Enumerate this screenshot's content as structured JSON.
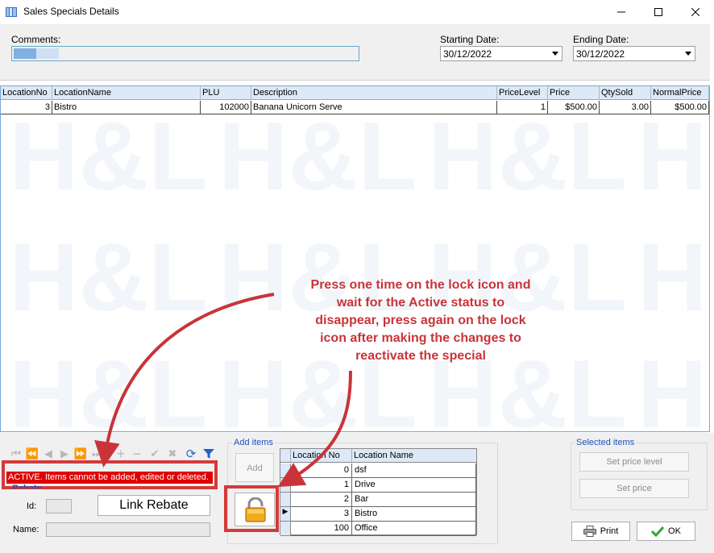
{
  "window": {
    "title": "Sales Specials Details"
  },
  "header": {
    "comments_label": "Comments:",
    "comments_value": "",
    "starting_date_label": "Starting Date:",
    "starting_date_value": "30/12/2022",
    "ending_date_label": "Ending Date:",
    "ending_date_value": "30/12/2022"
  },
  "grid": {
    "columns": [
      "LocationNo",
      "LocationName",
      "PLU",
      "Description",
      "PriceLevel",
      "Price",
      "QtySold",
      "NormalPrice"
    ],
    "rows": [
      [
        "3",
        "Bistro",
        "102000",
        "Banana Unicorn Serve",
        "1",
        "$500.00",
        "3.00",
        "$500.00"
      ]
    ]
  },
  "rebate": {
    "status_text": "ACTIVE.  Items cannot be added, edited or deleted.",
    "group_title": "Rebate",
    "id_label": "Id:",
    "name_label": "Name:",
    "link_rebate_label": "Link Rebate"
  },
  "add_items": {
    "title": "Add items",
    "add_label": "Add",
    "table": {
      "columns": [
        "Location No",
        "Location Name"
      ],
      "rows": [
        [
          "0",
          "dsf"
        ],
        [
          "1",
          "Drive"
        ],
        [
          "2",
          "Bar"
        ],
        [
          "3",
          "Bistro"
        ],
        [
          "100",
          "Office"
        ]
      ],
      "current_row_indicator": "▶"
    }
  },
  "selected_items": {
    "title": "Selected items",
    "set_price_level_label": "Set price level",
    "set_price_label": "Set price"
  },
  "footer": {
    "print_label": "Print",
    "ok_label": "OK"
  },
  "annotation": {
    "lines": [
      "Press one time on the lock icon and",
      "wait for the Active status to",
      "disappear, press again on the lock",
      "icon after making the changes to",
      "reactivate the special"
    ]
  },
  "colors": {
    "annotation_red": "#c8343a",
    "status_red": "#e00000",
    "accent_blue": "#1f4fbf",
    "grid_header": "#dde9f6"
  },
  "icons": [
    "app-icon",
    "minimize-icon",
    "maximize-icon",
    "close-icon",
    "first-record-icon",
    "prior-page-icon",
    "prior-record-icon",
    "next-record-icon",
    "next-page-icon",
    "last-record-icon",
    "insert-icon",
    "delete-icon",
    "post-icon",
    "cancel-icon",
    "refresh-icon",
    "filter-icon",
    "lock-icon",
    "printer-icon",
    "checkmark-icon",
    "dropdown-arrow-icon"
  ]
}
